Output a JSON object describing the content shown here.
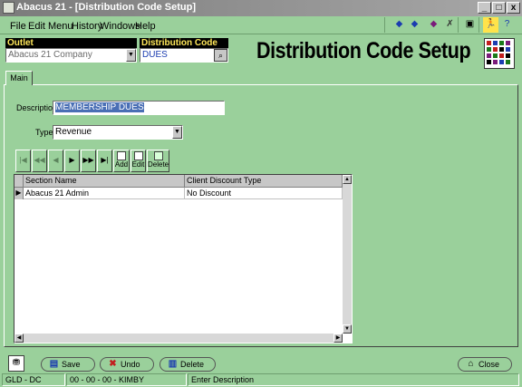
{
  "window": {
    "title": "Abacus 21 - [Distribution Code Setup]",
    "controls": [
      "_",
      "□",
      "x"
    ]
  },
  "menu": [
    "File",
    "Edit",
    "Menu",
    "History",
    "Windows",
    "Help"
  ],
  "header": {
    "outlet_label": "Outlet",
    "outlet_value": "Abacus 21 Company",
    "distcode_label": "Distribution Code",
    "distcode_value": "DUES",
    "page_title": "Distribution Code Setup"
  },
  "tabs": [
    "Main"
  ],
  "form": {
    "description_label": "Description",
    "description_value": "MEMBERSHIP DUES",
    "type_label": "Type",
    "type_value": "Revenue"
  },
  "navbar": {
    "add_label": "Add",
    "edit_label": "Edit",
    "delete_label": "Delete"
  },
  "grid": {
    "columns": [
      "Section Name",
      "Client Discount Type"
    ],
    "rows": [
      [
        "Abacus 21 Admin",
        "No Discount"
      ]
    ]
  },
  "buttons": {
    "save": "Save",
    "undo": "Undo",
    "delete": "Delete",
    "close": "Close"
  },
  "status": {
    "code": "GLD - DC",
    "session": "00 - 00 - 00 - KIMBY",
    "message": "Enter Description"
  },
  "colors": {
    "background": "#9ad09b",
    "label_bg": "#000000",
    "label_fg": "#ffe75a",
    "selection": "#4a6fb5"
  }
}
